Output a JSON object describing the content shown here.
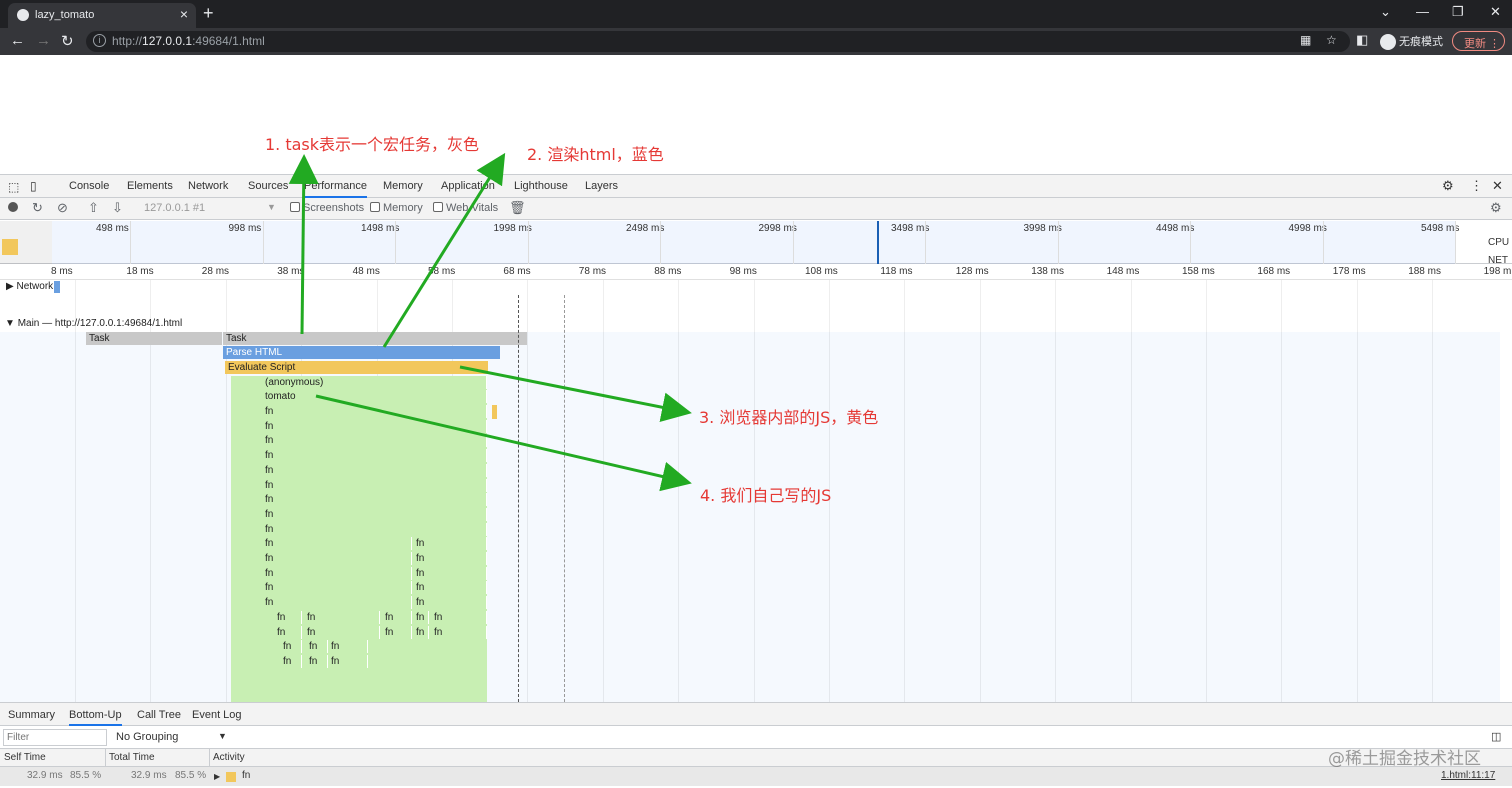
{
  "browser": {
    "tab_title": "lazy_tomato",
    "url_prefix": "http://",
    "url_host": "127.0.0.1",
    "url_rest": ":49684/1.html",
    "incognito_label": "无痕模式",
    "update_label": "更新"
  },
  "annotations": [
    "1. task表示一个宏任务，灰色",
    "2. 渲染html，蓝色",
    "3. 浏览器内部的JS，黄色",
    "4. 我们自己写的JS"
  ],
  "devtools": {
    "tabs": [
      "Console",
      "Elements",
      "Network",
      "Sources",
      "Performance",
      "Memory",
      "Application",
      "Lighthouse",
      "Layers"
    ],
    "active_tab": "Performance",
    "toolbar": {
      "profile_select": "127.0.0.1 #1",
      "screenshots": "Screenshots",
      "memory": "Memory",
      "web_vitals": "Web Vitals"
    },
    "overview": {
      "ticks": [
        "498 ms",
        "998 ms",
        "1498 ms",
        "1998 ms",
        "2498 ms",
        "2998 ms",
        "3498 ms",
        "3998 ms",
        "4498 ms",
        "4998 ms",
        "5498 ms"
      ],
      "cpu_label": "CPU",
      "net_label": "NET"
    },
    "ruler": [
      "8 ms",
      "18 ms",
      "28 ms",
      "38 ms",
      "48 ms",
      "58 ms",
      "68 ms",
      "78 ms",
      "88 ms",
      "98 ms",
      "108 ms",
      "118 ms",
      "128 ms",
      "138 ms",
      "148 ms",
      "158 ms",
      "168 ms",
      "178 ms",
      "188 ms",
      "198 m"
    ],
    "network_track": "Network",
    "main_track": "Main — http://127.0.0.1:49684/1.html",
    "flame": {
      "task": "Task",
      "parse_html": "Parse HTML",
      "evaluate_script": "Evaluate Script",
      "anonymous": "(anonymous)",
      "tomato": "tomato",
      "fn": "fn"
    },
    "bottom_tabs": [
      "Summary",
      "Bottom-Up",
      "Call Tree",
      "Event Log"
    ],
    "active_bottom_tab": "Bottom-Up",
    "filter_placeholder": "Filter",
    "grouping": "No Grouping",
    "columns": {
      "self": "Self Time",
      "total": "Total Time",
      "activity": "Activity"
    },
    "row": {
      "self_ms": "32.9 ms",
      "self_pct": "85.5 %",
      "total_ms": "32.9 ms",
      "total_pct": "85.5 %",
      "activity": "fn",
      "link": "1.html:11:17"
    }
  },
  "watermark": "@稀土掘金技术社区",
  "colors": {
    "task": "#c8c8c8",
    "parse_html": "#6a9fe0",
    "evaluate_script": "#f2c75c",
    "user_js": "#c8efb3",
    "annotation": "#e53935",
    "arrow": "#22aa22"
  }
}
